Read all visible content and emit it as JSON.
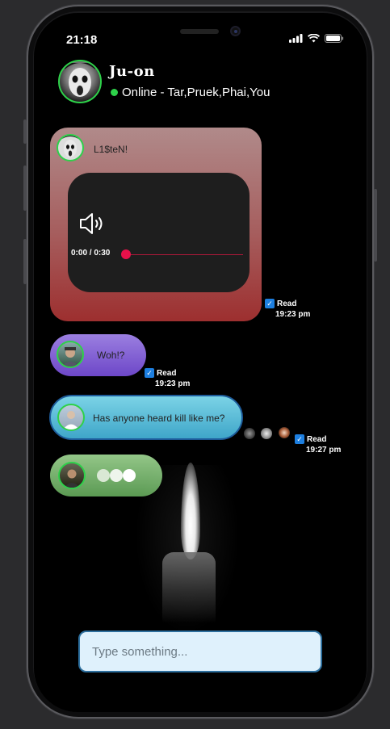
{
  "status_bar": {
    "time": "21:18"
  },
  "header": {
    "title": "Ju-on",
    "presence": "Online - Tar,Pruek,Phai,You"
  },
  "messages": [
    {
      "type": "audio",
      "sender_label": "L1$teN!",
      "player_time": "0:00 / 0:30",
      "progress": 0.0,
      "read_label": "Read",
      "read_time": "19:23 pm"
    },
    {
      "type": "text",
      "text": "Woh!?",
      "read_label": "Read",
      "read_time": "19:23 pm"
    },
    {
      "type": "text",
      "text": "Has anyone heard kill like me?",
      "read_label": "Read",
      "read_time": "19:27 pm"
    },
    {
      "type": "typing"
    }
  ],
  "composer": {
    "placeholder": "Type something..."
  },
  "colors": {
    "online": "#2ed14a",
    "audio_bubble": "#a65d5d",
    "woh_bubble": "#7a5bd0",
    "blue_bubble": "#4fb6d6",
    "typing_bubble": "#79b06e",
    "read_badge": "#1d7fe0",
    "progress": "#e8114a"
  }
}
